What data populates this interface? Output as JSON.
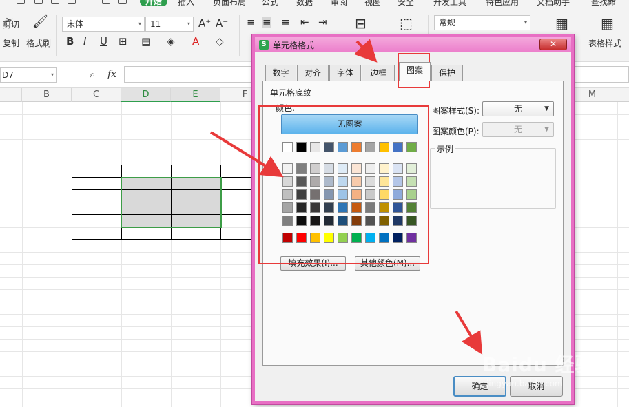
{
  "ribbon_tabs": [
    "开始",
    "插入",
    "页面布局",
    "公式",
    "数据",
    "审阅",
    "视图",
    "安全",
    "开发工具",
    "特色应用",
    "文档助手",
    "查找命"
  ],
  "clipboard": {
    "cut_label": "剪切",
    "copy_label": "复制",
    "format_painter_label": "格式刷"
  },
  "font": {
    "name": "宋体",
    "size": "11"
  },
  "number_format": "常规",
  "table_style_label": "表格样式",
  "name_box": "D7",
  "formula_icon": "fx",
  "columns": [
    "B",
    "C",
    "D",
    "E",
    "F",
    "M"
  ],
  "dialog": {
    "title": "单元格格式",
    "tabs": [
      "数字",
      "对齐",
      "字体",
      "边框",
      "图案",
      "保护"
    ],
    "active_tab": "图案",
    "section_title": "单元格底纹",
    "color_label": "颜色:",
    "no_pattern_button": "无图案",
    "fill_effects_button": "填充效果(I)...",
    "more_colors_button": "其他颜色(M)...",
    "pattern_style_label": "图案样式(S):",
    "pattern_style_value": "无",
    "pattern_color_label": "图案颜色(P):",
    "pattern_color_value": "无",
    "sample_label": "示例",
    "ok_button": "确定",
    "cancel_button": "取消",
    "close_icon": "close-icon"
  },
  "palette": {
    "theme_row": [
      "#ffffff",
      "#000000",
      "#e7e6e6",
      "#44546a",
      "#5b9bd5",
      "#ed7d31",
      "#a5a5a5",
      "#ffc000",
      "#4472c4",
      "#70ad47"
    ],
    "shade_rows": [
      [
        "#f2f2f2",
        "#7f7f7f",
        "#d0cece",
        "#d6dce4",
        "#deebf6",
        "#fbe5d5",
        "#ededed",
        "#fff2cc",
        "#dae3f3",
        "#e2efd9"
      ],
      [
        "#d8d8d8",
        "#595959",
        "#aeabab",
        "#adb9ca",
        "#bdd7ee",
        "#f7cbac",
        "#dbdbdb",
        "#fee599",
        "#b4c6e7",
        "#c5e0b3"
      ],
      [
        "#bfbfbf",
        "#3f3f3f",
        "#757070",
        "#8496b0",
        "#9dc3e6",
        "#f4b183",
        "#c9c9c9",
        "#ffd965",
        "#8eaadb",
        "#a8d08d"
      ],
      [
        "#a5a5a5",
        "#262626",
        "#3a3838",
        "#323f4f",
        "#2e75b5",
        "#c55a11",
        "#7b7b7b",
        "#bf9000",
        "#2f5496",
        "#538135"
      ],
      [
        "#7f7f7f",
        "#0c0c0c",
        "#171616",
        "#222a35",
        "#1e4e79",
        "#833c0b",
        "#525252",
        "#7f6000",
        "#1f3864",
        "#375623"
      ]
    ],
    "standard_row": [
      "#c00000",
      "#ff0000",
      "#ffc000",
      "#ffff00",
      "#92d050",
      "#00b050",
      "#00b0f0",
      "#0070c0",
      "#002060",
      "#7030a0"
    ]
  },
  "colors": {
    "dialog_frame": "#e86fc4",
    "highlight": "#e83a3a",
    "selection": "#3d9d47",
    "accent_tab": "#2e9e4d"
  },
  "watermark": {
    "brand": "Baidu 经验",
    "url": "jingyan.baidu.com"
  }
}
